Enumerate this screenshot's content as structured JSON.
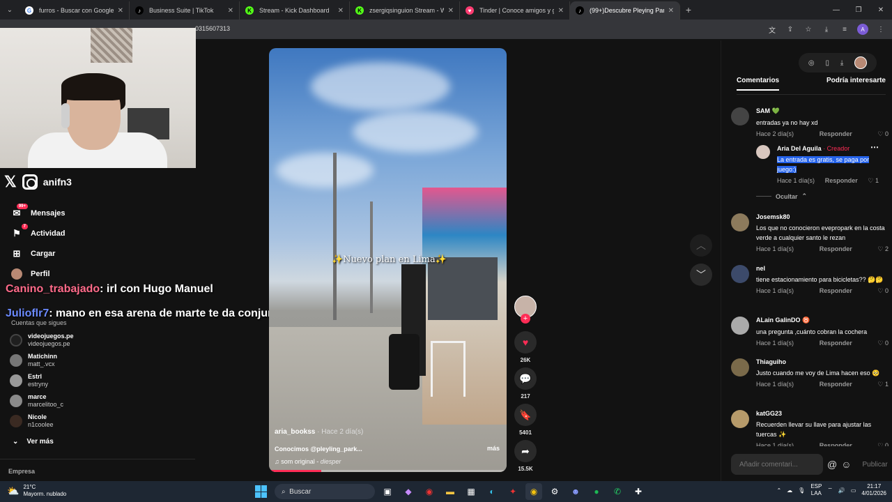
{
  "browser": {
    "tabs": [
      {
        "label": "furros - Buscar con Google",
        "fav": "G",
        "fav_color": "#ffffff"
      },
      {
        "label": "Business Suite | TikTok",
        "fav": "♪",
        "fav_color": "#000000"
      },
      {
        "label": "Stream - Kick Dashboard",
        "fav": "K",
        "fav_color": "#53fc18"
      },
      {
        "label": "zsergiqsinguion Stream - Watch",
        "fav": "K",
        "fav_color": "#53fc18"
      },
      {
        "label": "Tinder | Conoce amigos y gente",
        "fav": "♥",
        "fav_color": "#fe3c72"
      },
      {
        "label": "(99+)Descubre Pleying Park Di",
        "fav": "♪",
        "fav_color": "#000000"
      }
    ],
    "url_suffix": "0315607313"
  },
  "stream_overlay": {
    "handle": "anifn3",
    "chat": [
      {
        "user": "Canino_trabajado",
        "msg": ": irl con Hugo Manuel"
      },
      {
        "user": "Julioflr7",
        "msg": ": mano en esa arena de marte te da conjuntivitis"
      }
    ]
  },
  "leftnav": {
    "items": [
      {
        "label": "Mensajes",
        "badge": "99+"
      },
      {
        "label": "Actividad",
        "badge": "7"
      },
      {
        "label": "Cargar"
      },
      {
        "label": "Perfil"
      }
    ],
    "following_header": "Cuentas que sigues",
    "following": [
      {
        "name": "videojuegos.pe",
        "handle": "videojuegos.pe"
      },
      {
        "name": "Matichinn",
        "handle": "matt_.vcx"
      },
      {
        "name": "Estrl",
        "handle": "estryny"
      },
      {
        "name": "marce",
        "handle": "marcelitoo_c"
      },
      {
        "name": "Nicole",
        "handle": "n1coolee"
      }
    ],
    "ver_mas": "Ver más",
    "empresa": "Empresa"
  },
  "video": {
    "overlay_text": "Nuevo plan en Lima",
    "author": "aria_bookss",
    "ago": " · Hace 2 día(s)",
    "desc": "Conocimos @pleyling_park...",
    "mas": "más",
    "song": "som original",
    "artist": "diesper",
    "progress": 0.22
  },
  "actions": {
    "likes": "26K",
    "comments": "217",
    "saves": "5401",
    "shares": "15.5K"
  },
  "rpanel": {
    "tabs": [
      "Comentarios",
      "Podría interesarte"
    ],
    "comments": [
      {
        "user": "SAM 💚",
        "text": "entradas ya no hay xd",
        "ago": "Hace 2 día(s)",
        "reply": "Responder",
        "likes": "0"
      },
      {
        "user": "Aria Del Aguila",
        "creator": " · Creador",
        "text": "La entrada es gratis, se paga por juego:)",
        "ago": "Hace 1 día(s)",
        "reply": "Responder",
        "likes": "1"
      },
      {
        "user": "Josemsk80",
        "text": "Los que no conocieron evepropark en la costa verde a cualquier santo le rezan",
        "ago": "Hace 1 día(s)",
        "reply": "Responder",
        "likes": "2"
      },
      {
        "user": "nel",
        "text": "tiene estacionamiento para bicicletas?? 🤔🤔",
        "ago": "Hace 1 día(s)",
        "reply": "Responder",
        "likes": "0"
      },
      {
        "user": "ALain GalinDO ♉",
        "text": "una pregunta ,cuánto cobran la cochera",
        "ago": "Hace 1 día(s)",
        "reply": "Responder",
        "likes": "0"
      },
      {
        "user": "Thiaguiho",
        "text": "Justo cuando me voy de Lima hacen eso 🥺",
        "ago": "Hace 1 día(s)",
        "reply": "Responder",
        "likes": "1"
      },
      {
        "user": "katGG23",
        "text": "Recuerden llevar su llave para ajustar las tuercas ✨",
        "ago": "Hace 1 día(s)",
        "reply": "Responder",
        "likes": "0"
      }
    ],
    "ocultar": "Ocultar",
    "comment_placeholder": "Añadir comentari...",
    "publish": "Publicar"
  },
  "taskbar": {
    "temp": "21°C",
    "weather": "Mayorm. nublado",
    "search": "Buscar",
    "lang1": "ESP",
    "lang2": "LAA",
    "time": "21:17",
    "date": "4/01/2026"
  }
}
